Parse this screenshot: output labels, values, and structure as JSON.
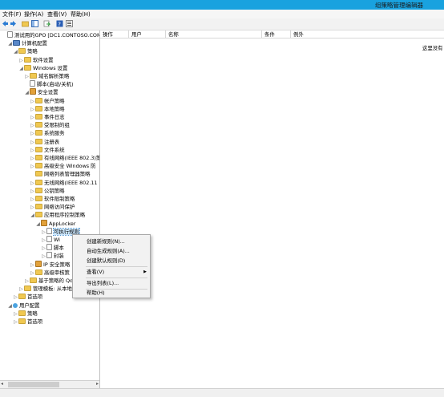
{
  "window": {
    "title": "组策略管理编辑器"
  },
  "menu": [
    "文件(F)",
    "操作(A)",
    "查看(V)",
    "帮助(H)"
  ],
  "toolbar_icons": [
    "back-icon",
    "forward-icon",
    "up-folder-icon",
    "show-hide-tree-icon",
    "export-icon",
    "help-icon",
    "properties-icon"
  ],
  "tree": [
    {
      "label": "测试用的GPO [DC1.CONTOSO.COM] 策",
      "exp": "",
      "icon": "doc"
    },
    {
      "label": "计算机配置",
      "exp": "◢",
      "icon": "pc"
    },
    {
      "label": "策略",
      "exp": "◢",
      "icon": "folder"
    },
    {
      "label": "软件设置",
      "exp": "▷",
      "icon": "folder"
    },
    {
      "label": "Windows 设置",
      "exp": "◢",
      "icon": "folder"
    },
    {
      "label": "域名解析策略",
      "exp": "▷",
      "icon": "folder"
    },
    {
      "label": "脚本(启动/关机)",
      "exp": "",
      "icon": "doc"
    },
    {
      "label": "安全设置",
      "exp": "◢",
      "icon": "shield"
    },
    {
      "label": "帐户策略",
      "exp": "▷",
      "icon": "folder"
    },
    {
      "label": "本地策略",
      "exp": "▷",
      "icon": "folder"
    },
    {
      "label": "事件日志",
      "exp": "▷",
      "icon": "folder"
    },
    {
      "label": "受限制的组",
      "exp": "▷",
      "icon": "folder"
    },
    {
      "label": "系统服务",
      "exp": "▷",
      "icon": "folder"
    },
    {
      "label": "注册表",
      "exp": "▷",
      "icon": "folder"
    },
    {
      "label": "文件系统",
      "exp": "▷",
      "icon": "folder"
    },
    {
      "label": "有线网络(IEEE 802.3)策",
      "exp": "▷",
      "icon": "folder"
    },
    {
      "label": "高级安全 Windows 防",
      "exp": "▷",
      "icon": "folder"
    },
    {
      "label": "网络列表管理器策略",
      "exp": "",
      "icon": "folder"
    },
    {
      "label": "无线网络(IEEE 802.11",
      "exp": "▷",
      "icon": "folder"
    },
    {
      "label": "公钥策略",
      "exp": "▷",
      "icon": "folder"
    },
    {
      "label": "软件限制策略",
      "exp": "▷",
      "icon": "folder"
    },
    {
      "label": "网络访问保护",
      "exp": "▷",
      "icon": "folder"
    },
    {
      "label": "应用程序控制策略",
      "exp": "◢",
      "icon": "folder"
    },
    {
      "label": "AppLocker",
      "exp": "◢",
      "icon": "shield"
    },
    {
      "label": "可执行规则",
      "exp": "▷",
      "icon": "doc",
      "selected": true
    },
    {
      "label": "Wi",
      "exp": "▷",
      "icon": "doc"
    },
    {
      "label": "脚本",
      "exp": "▷",
      "icon": "doc"
    },
    {
      "label": "封装",
      "exp": "▷",
      "icon": "doc"
    },
    {
      "label": "IP 安全策略",
      "exp": "▷",
      "icon": "shield"
    },
    {
      "label": "高级审核策",
      "exp": "▷",
      "icon": "folder"
    },
    {
      "label": "基于策略的 Qo",
      "exp": "▷",
      "icon": "folder"
    },
    {
      "label": "管理模板: 从本地",
      "exp": "▷",
      "icon": "folder"
    },
    {
      "label": "首选项",
      "exp": "▷",
      "icon": "folder"
    },
    {
      "label": "用户配置",
      "exp": "◢",
      "icon": "user"
    },
    {
      "label": "策略",
      "exp": "▷",
      "icon": "folder"
    },
    {
      "label": "首选项",
      "exp": "▷",
      "icon": "folder"
    }
  ],
  "columns": [
    "操作",
    "用户",
    "名称",
    "条件",
    "例外"
  ],
  "empty_message": "这里没有",
  "context_menu": [
    {
      "label": "创建新规则(N)...",
      "submenu": false
    },
    {
      "label": "自动生成规则(A)...",
      "submenu": false
    },
    {
      "label": "创建默认规则(D)",
      "submenu": false
    },
    {
      "label": "查看(V)",
      "submenu": true
    },
    {
      "label": "导出列表(L)...",
      "submenu": false
    },
    {
      "label": "帮助(H)",
      "submenu": false
    }
  ]
}
